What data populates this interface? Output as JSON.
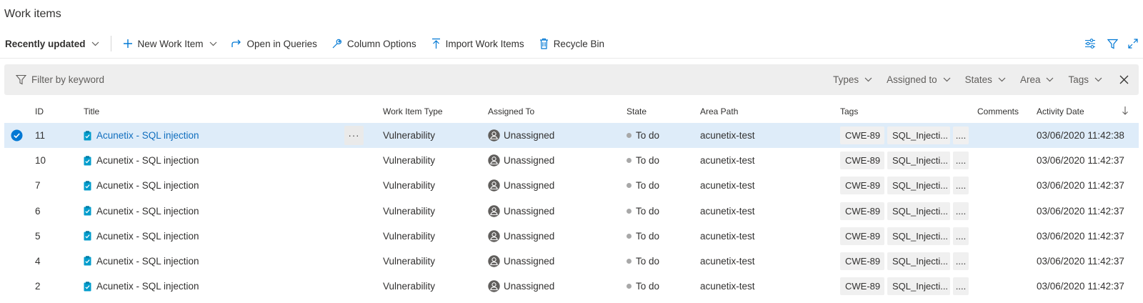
{
  "page": {
    "title": "Work items"
  },
  "toolbar": {
    "view_selector": "Recently updated",
    "new_work_item": "New Work Item",
    "open_in_queries": "Open in Queries",
    "column_options": "Column Options",
    "import_work_items": "Import Work Items",
    "recycle_bin": "Recycle Bin",
    "right_icons": [
      "view-options-icon",
      "filter-icon",
      "fullscreen-icon"
    ]
  },
  "filter": {
    "placeholder": "Filter by keyword",
    "dropdowns": [
      "Types",
      "Assigned to",
      "States",
      "Area",
      "Tags"
    ]
  },
  "columns": {
    "id": "ID",
    "title": "Title",
    "type": "Work Item Type",
    "assigned": "Assigned To",
    "state": "State",
    "area": "Area Path",
    "tags": "Tags",
    "comments": "Comments",
    "activity": "Activity Date"
  },
  "rows": [
    {
      "id": "11",
      "title": "Acunetix - SQL injection",
      "type": "Vulnerability",
      "assigned": "Unassigned",
      "state": "To do",
      "area": "acunetix-test",
      "tags": [
        "CWE-89",
        "SQL_Injecti...",
        "...."
      ],
      "date": "03/06/2020 11:42:38",
      "selected": true,
      "more": "···"
    },
    {
      "id": "10",
      "title": "Acunetix - SQL injection",
      "type": "Vulnerability",
      "assigned": "Unassigned",
      "state": "To do",
      "area": "acunetix-test",
      "tags": [
        "CWE-89",
        "SQL_Injecti...",
        "...."
      ],
      "date": "03/06/2020 11:42:37"
    },
    {
      "id": "7",
      "title": "Acunetix - SQL injection",
      "type": "Vulnerability",
      "assigned": "Unassigned",
      "state": "To do",
      "area": "acunetix-test",
      "tags": [
        "CWE-89",
        "SQL_Injecti...",
        "...."
      ],
      "date": "03/06/2020 11:42:37"
    },
    {
      "id": "6",
      "title": "Acunetix - SQL injection",
      "type": "Vulnerability",
      "assigned": "Unassigned",
      "state": "To do",
      "area": "acunetix-test",
      "tags": [
        "CWE-89",
        "SQL_Injecti...",
        "...."
      ],
      "date": "03/06/2020 11:42:37"
    },
    {
      "id": "5",
      "title": "Acunetix - SQL injection",
      "type": "Vulnerability",
      "assigned": "Unassigned",
      "state": "To do",
      "area": "acunetix-test",
      "tags": [
        "CWE-89",
        "SQL_Injecti...",
        "...."
      ],
      "date": "03/06/2020 11:42:37"
    },
    {
      "id": "4",
      "title": "Acunetix - SQL injection",
      "type": "Vulnerability",
      "assigned": "Unassigned",
      "state": "To do",
      "area": "acunetix-test",
      "tags": [
        "CWE-89",
        "SQL_Injecti...",
        "...."
      ],
      "date": "03/06/2020 11:42:37"
    },
    {
      "id": "2",
      "title": "Acunetix - SQL injection",
      "type": "Vulnerability",
      "assigned": "Unassigned",
      "state": "To do",
      "area": "acunetix-test",
      "tags": [
        "CWE-89",
        "SQL_Injecti...",
        "...."
      ],
      "date": "03/06/2020 11:42:37"
    }
  ],
  "colors": {
    "accent": "#0078d4",
    "selected_row": "#deecf9",
    "work_item_icon": "#009ccc",
    "state_dot": "#a8a8a8"
  }
}
